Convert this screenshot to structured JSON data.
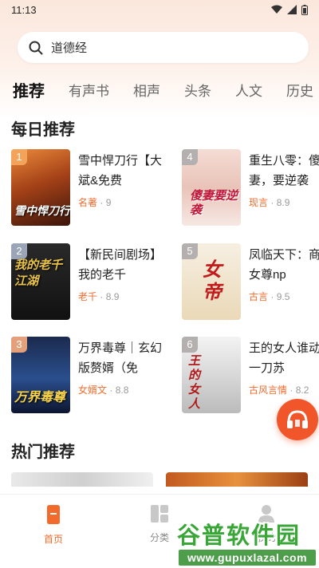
{
  "status": {
    "time": "11:13"
  },
  "search": {
    "text": "道德经"
  },
  "tabs": [
    {
      "label": "推荐"
    },
    {
      "label": "有声书"
    },
    {
      "label": "相声"
    },
    {
      "label": "头条"
    },
    {
      "label": "人文"
    },
    {
      "label": "历史"
    }
  ],
  "daily": {
    "title": "每日推荐",
    "books": [
      {
        "rank": "1",
        "title": "雪中悍刀行【大斌&免费",
        "category": "名著",
        "score": "· 9",
        "cover_text": "雪中悍刀行"
      },
      {
        "rank": "2",
        "title": "【新民间剧场】我的老千",
        "category": "老千",
        "score": "· 8.9",
        "cover_text": "我的老千江湖"
      },
      {
        "rank": "3",
        "title": "万界毒尊｜玄幻版赘婿（免",
        "category": "女婿文",
        "score": "· 8.8",
        "cover_text": "万界毒尊"
      },
      {
        "rank": "4",
        "title": "重生八零：傻妻，要逆袭",
        "category": "现言",
        "score": "· 8.9",
        "cover_text": "傻妻要逆袭"
      },
      {
        "rank": "5",
        "title": "凤临天下：商｜女尊np",
        "category": "古言",
        "score": "· 9.5",
        "cover_text": "女帝"
      },
      {
        "rank": "6",
        "title": "王的女人谁动｜一刀苏",
        "category": "古风言情",
        "score": "· 8.2",
        "cover_text": "王的女人"
      }
    ]
  },
  "hot": {
    "title": "热门推荐"
  },
  "bottom_nav": [
    {
      "label": "首页"
    },
    {
      "label": "分类"
    },
    {
      "label": "我的"
    }
  ],
  "watermark": {
    "title": "谷普软件园",
    "url": "www.gupuxlazal.com"
  },
  "colors": {
    "accent": "#f26b2c",
    "audio": "#f1562b"
  }
}
